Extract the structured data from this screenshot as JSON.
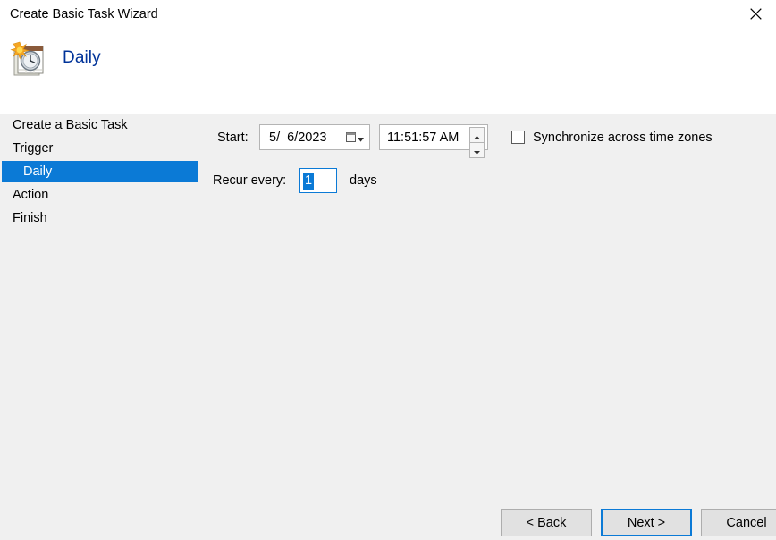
{
  "window": {
    "title": "Create Basic Task Wizard",
    "close_icon": "close-icon"
  },
  "header": {
    "title": "Daily",
    "icon": "daily-task-calendar-clock-icon"
  },
  "sidebar": {
    "items": [
      {
        "label": "Create a Basic Task",
        "selected": false,
        "sub": false
      },
      {
        "label": "Trigger",
        "selected": false,
        "sub": false
      },
      {
        "label": "Daily",
        "selected": true,
        "sub": true
      },
      {
        "label": "Action",
        "selected": false,
        "sub": false
      },
      {
        "label": "Finish",
        "selected": false,
        "sub": false
      }
    ],
    "selection_color": "#0b7ad6"
  },
  "form": {
    "start_label": "Start:",
    "start_date_value": "5/  6/2023",
    "start_date_placeholder": "M/  D/YYYY",
    "start_time_value": "11:51:57 AM",
    "start_time_placeholder": "hh:mm:ss AM",
    "sync_checkbox_label": "Synchronize across time zones",
    "sync_checkbox_checked": false,
    "recur_label": "Recur every:",
    "recur_value": "1",
    "recur_unit_label": "days",
    "focus_color": "#0b7ad6"
  },
  "footer": {
    "back_label": "< Back",
    "next_label": "Next >",
    "cancel_label": "Cancel",
    "default_button": "Next >"
  }
}
